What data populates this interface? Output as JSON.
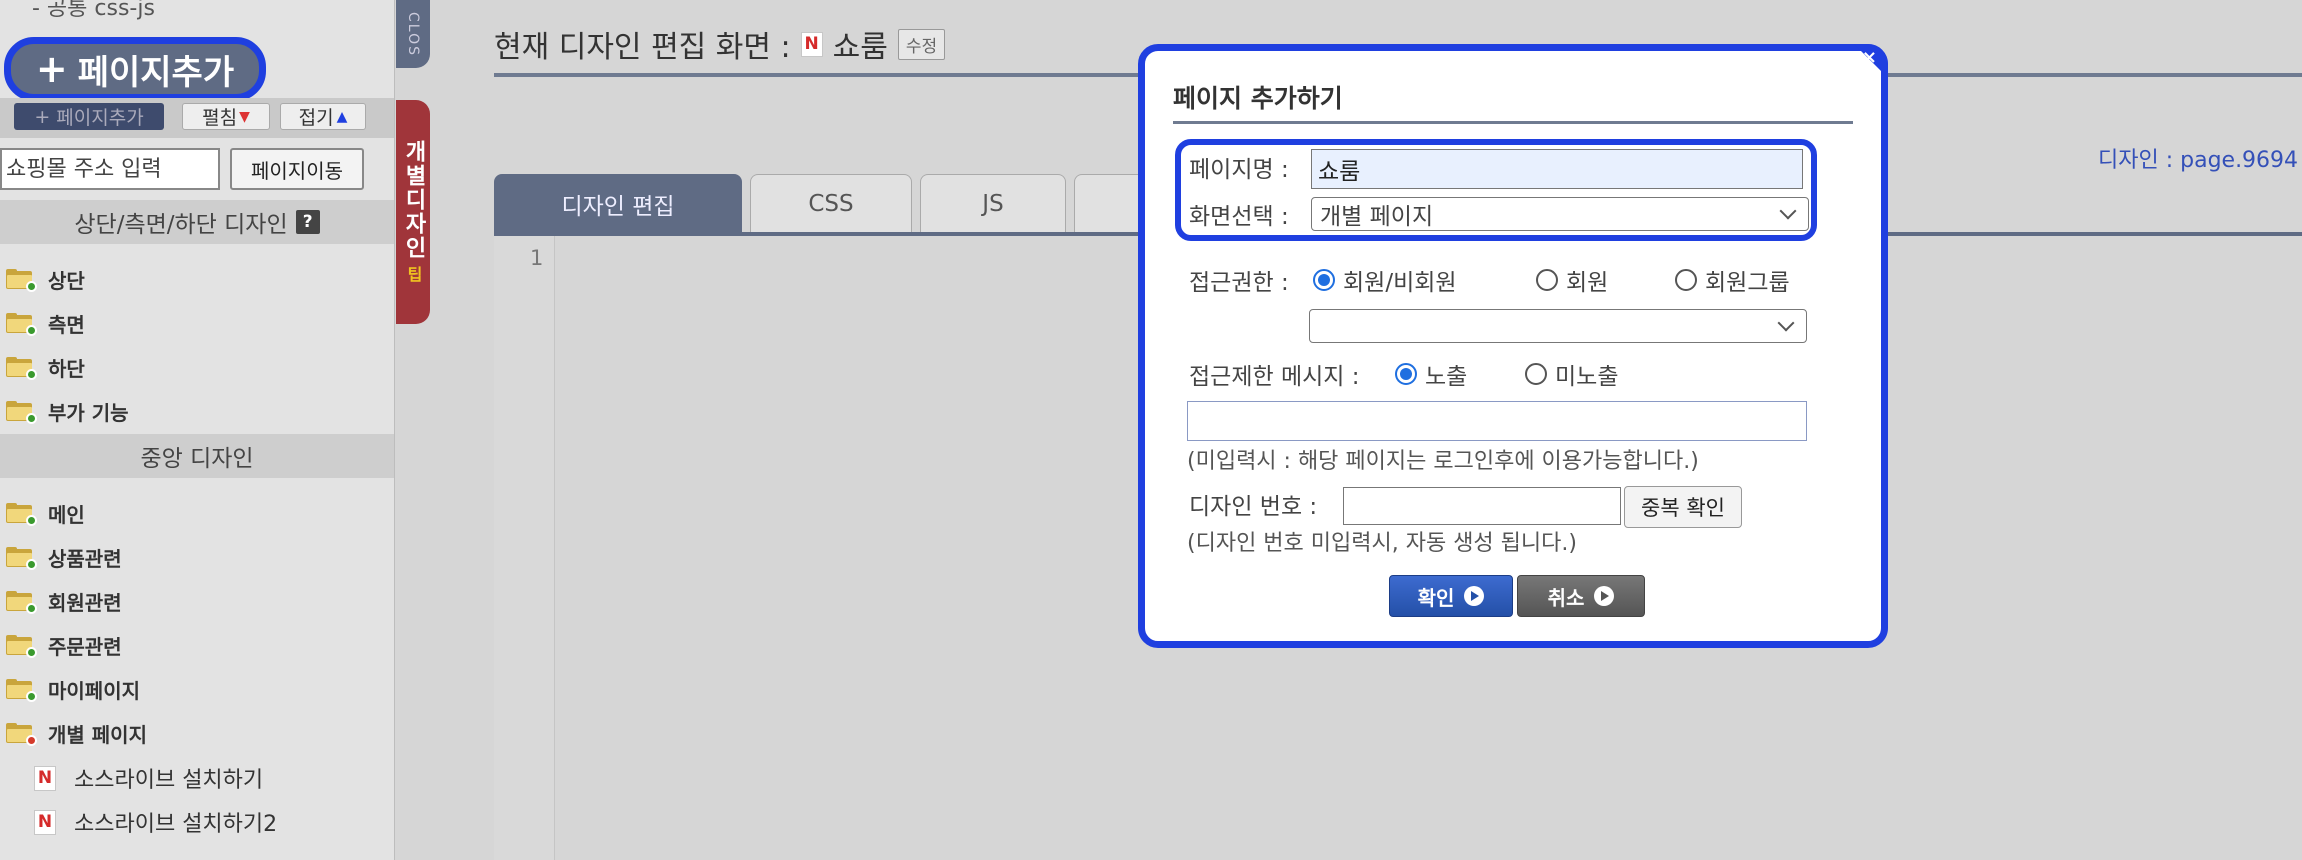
{
  "sidebar": {
    "top_link": "- 공통 css-js",
    "big_add_label": "페이지추가",
    "toolbar": {
      "add_label": "페이지추가",
      "open_label": "펼침",
      "fold_label": "접기"
    },
    "url_placeholder": "쇼핑몰 주소 입력",
    "go_label": "페이지이동",
    "section_top": "상단/측면/하단 디자인",
    "help_label": "?",
    "top_items": [
      {
        "label": "상단"
      },
      {
        "label": "측면"
      },
      {
        "label": "하단"
      },
      {
        "label": "부가 기능"
      }
    ],
    "section_center": "중앙 디자인",
    "center_items": [
      {
        "label": "메인"
      },
      {
        "label": "상품관련"
      },
      {
        "label": "회원관련"
      },
      {
        "label": "주문관련"
      },
      {
        "label": "마이페이지"
      },
      {
        "label": "개별 페이지"
      }
    ],
    "pages": [
      {
        "icon": "N",
        "label": "소스라이브 설치하기"
      },
      {
        "icon": "N",
        "label": "소스라이브 설치하기2"
      }
    ]
  },
  "side_tabs": {
    "close": "CLOS",
    "design": "개별디자인",
    "tip": "팁"
  },
  "main": {
    "title_prefix": "현재 디자인 편집 화면 :",
    "page_icon": "N",
    "page_name": "쇼룸",
    "edit_badge": "수정",
    "design_number": "디자인 : page.9694",
    "tabs": [
      {
        "label": "디자인 편집"
      },
      {
        "label": "CSS"
      },
      {
        "label": "JS"
      }
    ],
    "line_number": "1"
  },
  "modal": {
    "close": "×",
    "title": "페이지 추가하기",
    "page_name_label": "페이지명 :",
    "page_name_value": "쇼룸",
    "screen_label": "화면선택 :",
    "screen_value": "개별 페이지",
    "access_label": "접근권한 :",
    "access_options": [
      {
        "label": "회원/비회원",
        "checked": true
      },
      {
        "label": "회원",
        "checked": false
      },
      {
        "label": "회원그룹",
        "checked": false
      }
    ],
    "group_value": "",
    "restrict_label": "접근제한 메시지 :",
    "restrict_options": [
      {
        "label": "노출",
        "checked": true
      },
      {
        "label": "미노출",
        "checked": false
      }
    ],
    "restrict_message": "",
    "restrict_note": "(미입력시 : 해당 페이지는 로그인후에 이용가능합니다.)",
    "design_no_label": "디자인 번호 :",
    "design_no_value": "",
    "dup_check": "중복 확인",
    "design_no_note": "(디자인 번호 미입력시, 자동 생성 됩니다.)",
    "confirm": "확인",
    "cancel": "취소"
  },
  "colors": {
    "highlight": "#1f3fe0",
    "nav_dark": "#5f6b84",
    "design_tab": "#a0353a",
    "link_blue": "#3450b8"
  }
}
